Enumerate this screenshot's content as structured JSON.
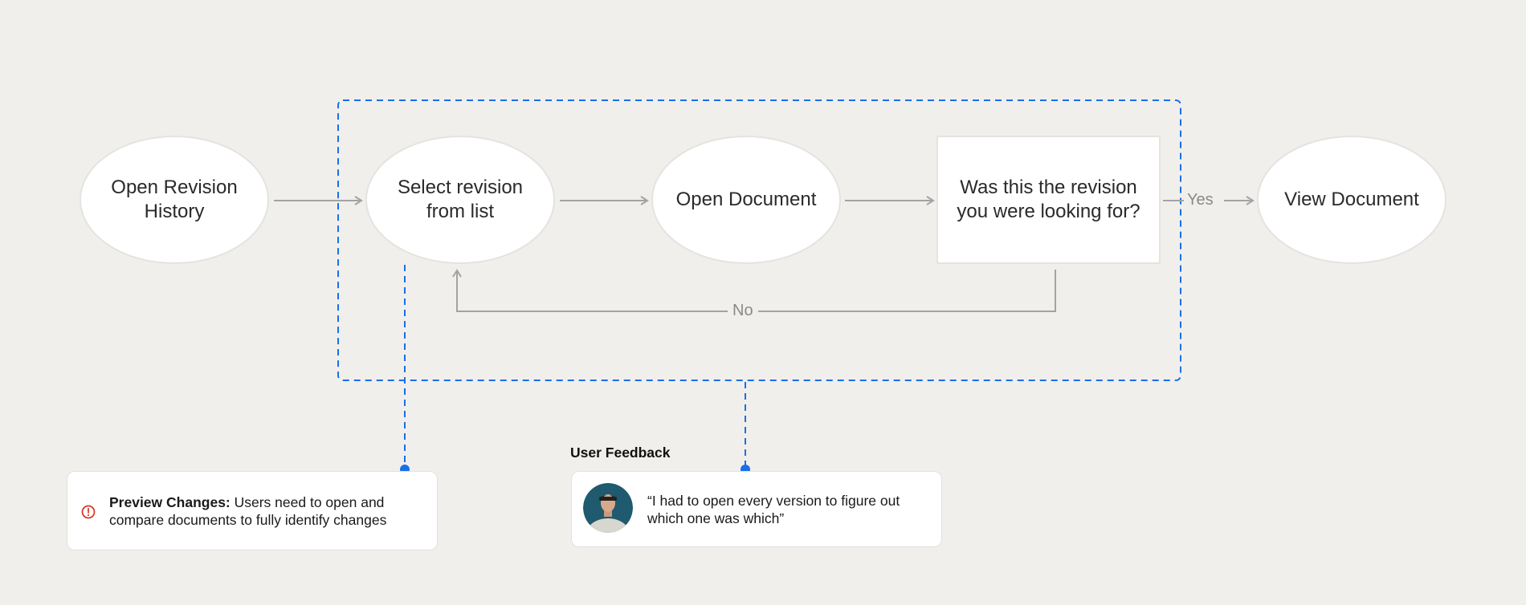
{
  "diagram": {
    "nodes": {
      "open_revision_history": "Open Revision History",
      "select_revision": "Select revision from list",
      "open_document": "Open Document",
      "decision": "Was this the revision you were looking for?",
      "view_document": "View Document"
    },
    "edges": {
      "yes_label": "Yes",
      "no_label": "No"
    },
    "colors": {
      "highlight_dash": "#1a6fe8",
      "connector": "#a3a3a3",
      "warning": "#d93a2b"
    }
  },
  "pain_point": {
    "title": "Preview Changes:",
    "body": " Users need to open and compare documents to fully identify changes",
    "icon": "warning-circle-icon"
  },
  "feedback": {
    "heading": "User Feedback",
    "quote": "“I had to open every version to figure out which one was which”",
    "icon": "user-avatar"
  }
}
